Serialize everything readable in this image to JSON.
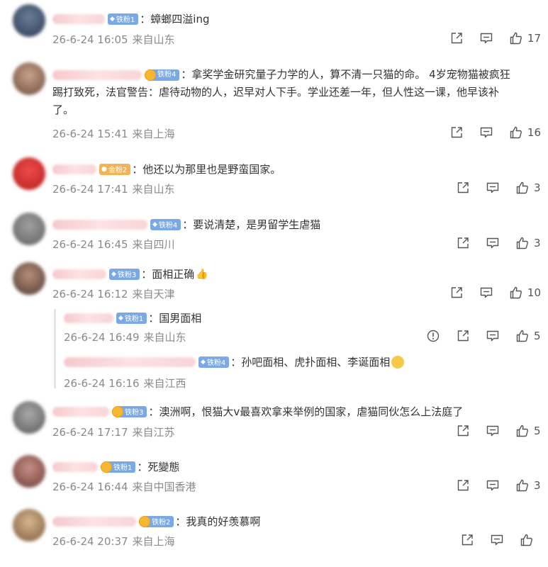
{
  "comments": [
    {
      "badge_label": "铁粉1",
      "content": "：蟑螂四溢ing",
      "date": "26-6-24 16:05",
      "location": "来自山东",
      "likes": "17"
    },
    {
      "badge_label": "铁粉4",
      "content_lines": [
        "：拿奖学金研究量子力学的人，算不清一只猫的命。 4岁宠物猫被疯狂",
        "踢打致死，法官警告：虐待动物的人，迟早对人下手。学业还差一年，但人性这一课，他早该补",
        "了。"
      ],
      "date": "26-6-24 15:41",
      "location": "来自上海",
      "likes": "16"
    },
    {
      "badge_label": "金粉2",
      "content": "：他还以为那里也是野蛮国家。",
      "date": "26-6-24 17:41",
      "location": "来自山东",
      "likes": "3"
    },
    {
      "badge_label": "铁粉4",
      "content": "：要说清楚，是男留学生虐猫",
      "date": "26-6-24 16:45",
      "location": "来自四川",
      "likes": "3"
    },
    {
      "badge_label": "铁粉3",
      "content": "：面相正确",
      "date": "26-6-24 16:12",
      "location": "来自天津",
      "likes": "10",
      "replies": [
        {
          "badge_label": "铁粉1",
          "content": "：国男面相",
          "date": "26-6-24 16:49",
          "location": "来自山东",
          "likes": "5"
        },
        {
          "badge_label": "铁粉4",
          "content": "：孙吧面相、虎扑面相、李诞面相",
          "date": "26-6-24 16:16",
          "location": "来自江西"
        }
      ]
    },
    {
      "badge_label": "铁粉3",
      "content": "：澳洲啊，恨猫大v最喜欢拿来举例的国家，虐猫同伙怎么上法庭了",
      "date": "26-6-24 17:17",
      "location": "来自江苏",
      "likes": "5"
    },
    {
      "badge_label": "铁粉1",
      "content": "：死變態",
      "date": "26-6-24 16:44",
      "location": "来自中国香港",
      "likes": "3"
    },
    {
      "badge_label": "铁粉2",
      "content": "：我真的好羡慕啊",
      "date": "26-6-24 20:37",
      "location": "来自上海"
    }
  ],
  "icons": {
    "share": "share-icon",
    "comment": "comment-icon",
    "like": "thumb-up-icon",
    "report": "report-icon"
  },
  "colors": {
    "badge_blue": "#7aa9e6",
    "badge_gold": "#f0b357",
    "meta_gray": "#8a8a8a",
    "text": "#333333"
  }
}
